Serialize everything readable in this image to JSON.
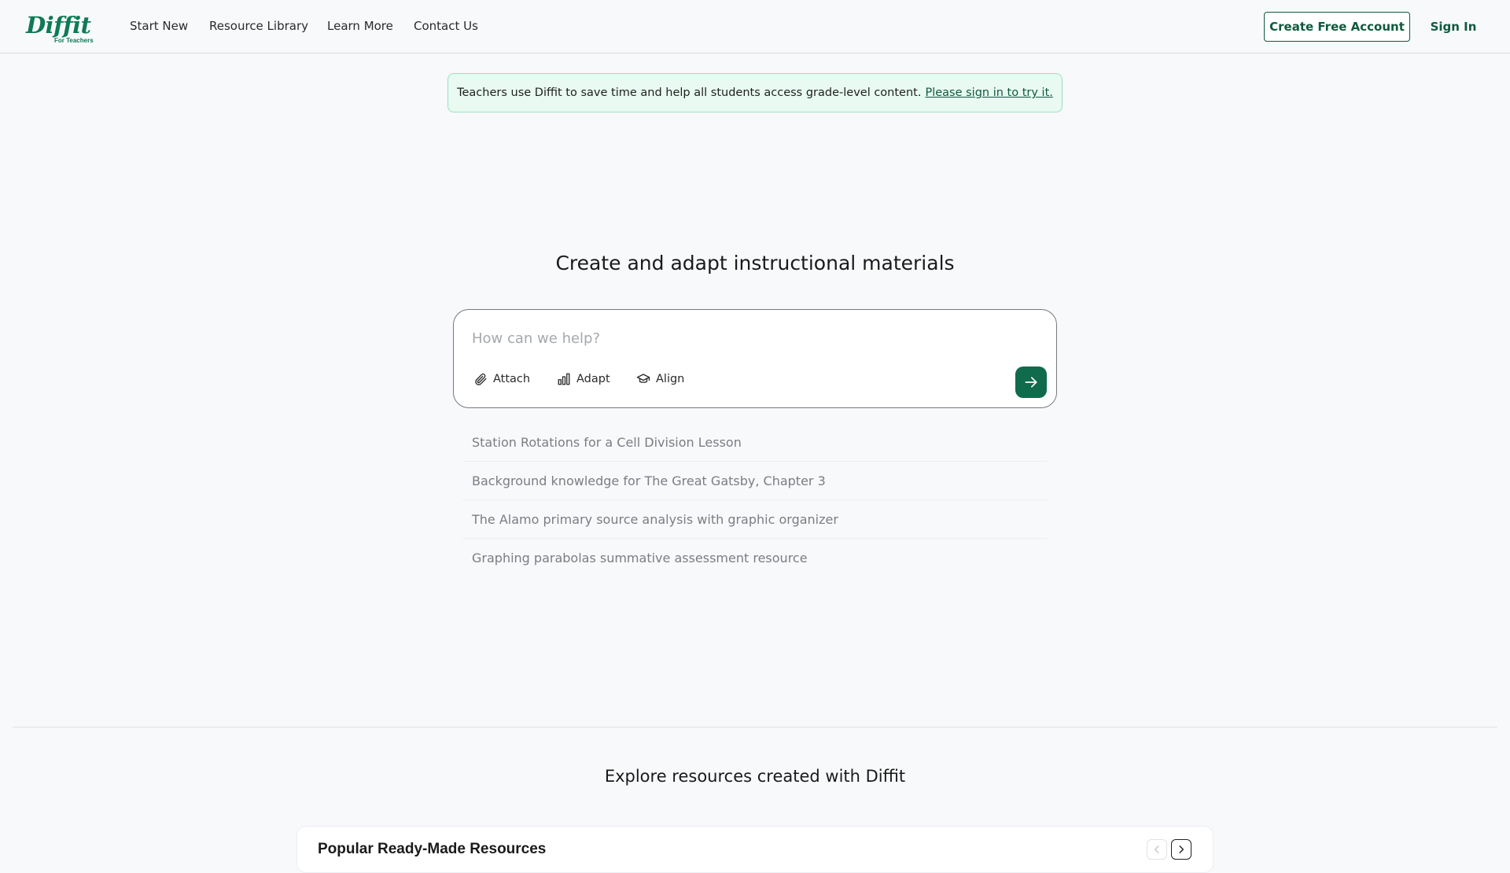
{
  "header": {
    "logo_text": "Diffit",
    "logo_subtitle": "For Teachers",
    "nav": [
      {
        "label": "Start New"
      },
      {
        "label": "Resource Library"
      },
      {
        "label": "Learn More"
      },
      {
        "label": "Contact Us"
      }
    ],
    "create_account_label": "Create Free Account",
    "sign_in_label": "Sign In"
  },
  "banner": {
    "text": "Teachers use Diffit to save time and help all students access grade-level content.",
    "link_text": "Please sign in to try it."
  },
  "hero": {
    "title": "Create and adapt instructional materials",
    "prompt_placeholder": "How can we help?",
    "tools": [
      {
        "label": "Attach",
        "icon": "paperclip-icon"
      },
      {
        "label": "Adapt",
        "icon": "bar-chart-icon"
      },
      {
        "label": "Align",
        "icon": "graduation-cap-icon"
      }
    ],
    "send_icon": "arrow-right-icon"
  },
  "suggestions": [
    "Station Rotations for a Cell Division Lesson",
    "Background knowledge for The Great Gatsby, Chapter 3",
    "The Alamo primary source analysis with graphic organizer",
    "Graphing parabolas summative assessment resource"
  ],
  "explore": {
    "title": "Explore resources created with Diffit",
    "card_title": "Popular Ready-Made Resources"
  },
  "colors": {
    "brand": "#0f7a55",
    "brand_dark": "#0f5a3e",
    "send_button": "#0f6b4b",
    "banner_bg": "#e8faf1",
    "banner_border": "#9be0c0"
  }
}
